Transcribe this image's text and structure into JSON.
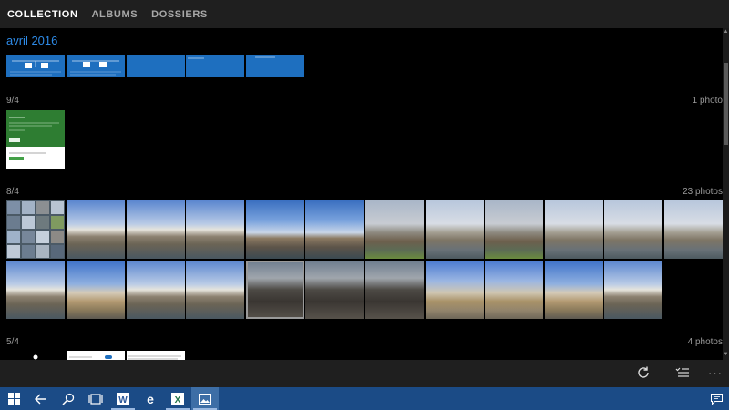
{
  "tabs": [
    {
      "label": "COLLECTION",
      "active": true
    },
    {
      "label": "ALBUMS",
      "active": false
    },
    {
      "label": "DOSSIERS",
      "active": false
    }
  ],
  "month_header": "avril 2016",
  "groups": [
    {
      "date": "9/4",
      "count": "1 photo"
    },
    {
      "date": "8/4",
      "count": "23 photos"
    },
    {
      "date": "5/4",
      "count": "4 photos"
    }
  ],
  "command_bar": {
    "icons": [
      "refresh-icon",
      "select-icon",
      "more-icon"
    ],
    "more_label": "···"
  },
  "taskbar": {
    "items": [
      "windows-start-icon",
      "back-icon",
      "search-icon",
      "task-view-icon",
      "word-icon",
      "edge-icon",
      "excel-icon",
      "photos-icon"
    ],
    "right_icon": "action-center-icon"
  },
  "colors": {
    "accent": "#2e8ae6",
    "header_bg": "#1f1f1f",
    "taskbar_bg": "#1b4b86"
  }
}
